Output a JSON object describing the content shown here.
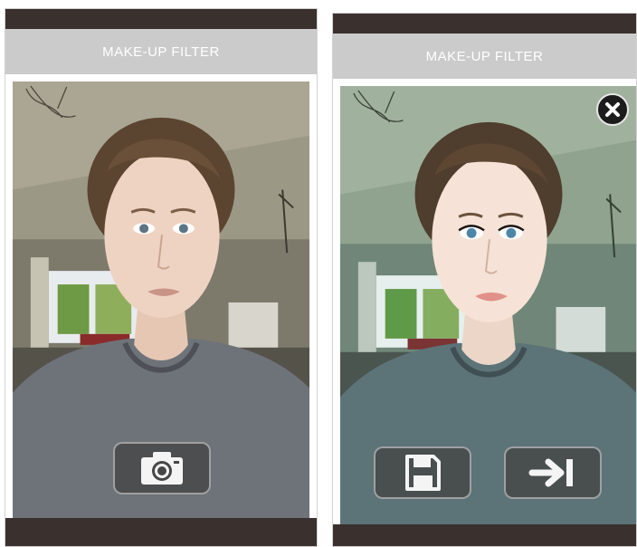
{
  "left_screen": {
    "title": "MAKE-UP FILTER",
    "camera_button": {
      "icon": "camera-icon"
    }
  },
  "right_screen": {
    "title": "MAKE-UP FILTER",
    "close_button": {
      "icon": "close-icon"
    },
    "save_button": {
      "icon": "save-icon"
    },
    "next_button": {
      "icon": "arrow-right-bar-icon"
    }
  },
  "colors": {
    "status_bar": "#3a302d",
    "title_bar": "#cbcbcb",
    "title_text": "#ffffff",
    "button_fill": "#464646"
  }
}
